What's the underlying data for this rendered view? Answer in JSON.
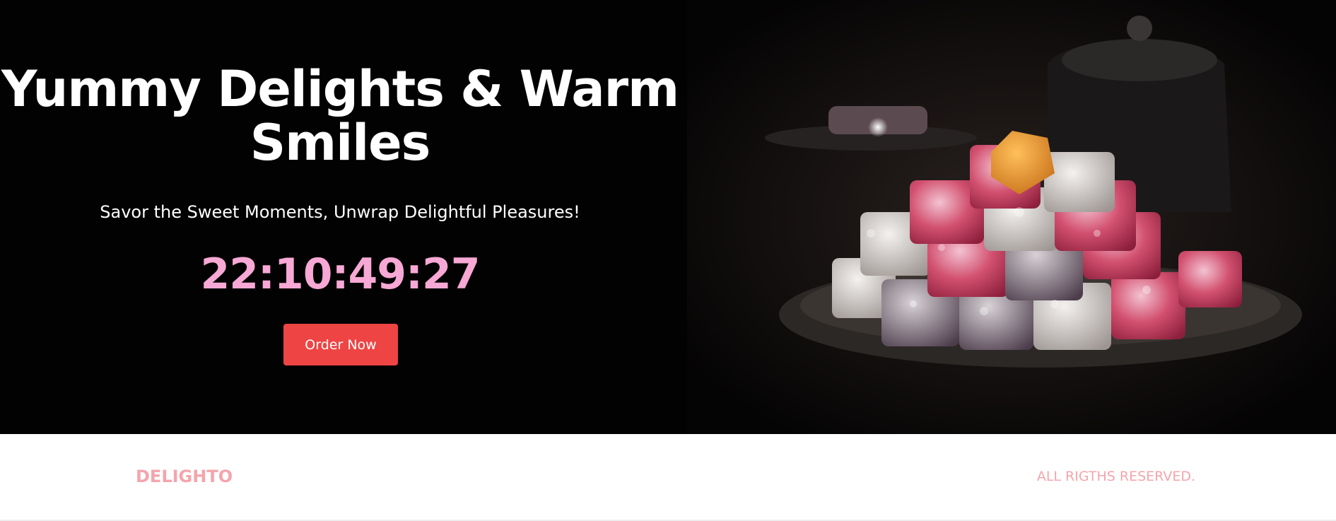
{
  "hero": {
    "title": "Yummy Delights & Warm Smiles",
    "subtitle": "Savor the Sweet Moments, Unwrap Delightful Pleasures!",
    "countdown": "22:10:49:27",
    "order_label": "Order Now",
    "image_alt": "Plate of powdered Turkish delight"
  },
  "footer": {
    "brand": "DELIGHTO",
    "rights": "ALL RIGTHS RESERVED."
  },
  "colors": {
    "hero_bg": "#020202",
    "countdown": "#f7a8d4",
    "button": "#ef4444",
    "footer_text": "#f4a5ac"
  }
}
